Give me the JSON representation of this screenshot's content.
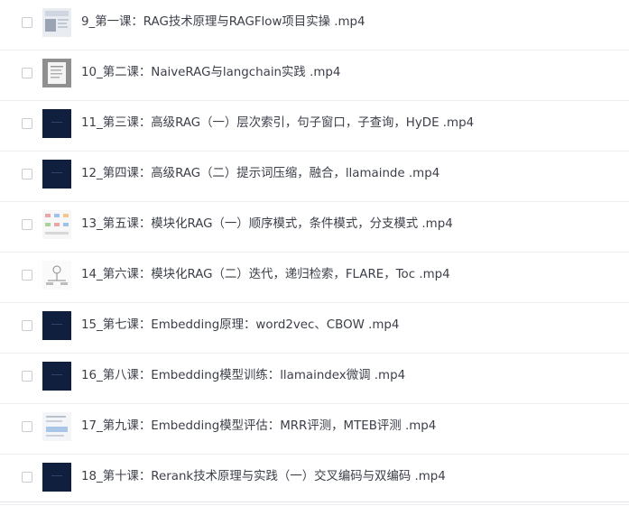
{
  "files": [
    {
      "name": "9_第一课：RAG技术原理与RAGFlow项目实操 .mp4",
      "thumb": "slide-light"
    },
    {
      "name": "10_第二课：NaiveRAG与langchain实践 .mp4",
      "thumb": "slide-gray"
    },
    {
      "name": "11_第三课：高级RAG（一）层次索引，句子窗口，子查询，HyDE .mp4",
      "thumb": "dark-video"
    },
    {
      "name": "12_第四课：高级RAG（二）提示词压缩，融合，llamainde .mp4",
      "thumb": "dark-video"
    },
    {
      "name": "13_第五课：模块化RAG（一）顺序模式，条件模式，分支模式 .mp4",
      "thumb": "diagram-color"
    },
    {
      "name": "14_第六课：模块化RAG（二）迭代，递归检索，FLARE，Toc .mp4",
      "thumb": "diagram-sketch"
    },
    {
      "name": "15_第七课：Embedding原理：word2vec、CBOW .mp4",
      "thumb": "dark-video"
    },
    {
      "name": "16_第八课：Embedding模型训练：llamaindex微调 .mp4",
      "thumb": "dark-video"
    },
    {
      "name": "17_第九课：Embedding模型评估：MRR评测，MTEB评测 .mp4",
      "thumb": "doc-blue"
    },
    {
      "name": "18_第十课：Rerank技术原理与实践（一）交叉编码与双编码 .mp4",
      "thumb": "dark-video"
    }
  ],
  "colors": {
    "text": "#3b3f48",
    "checkbox_border": "#c8ccd4",
    "divider": "#eceef2",
    "dark_thumb": "#0f1a33"
  }
}
